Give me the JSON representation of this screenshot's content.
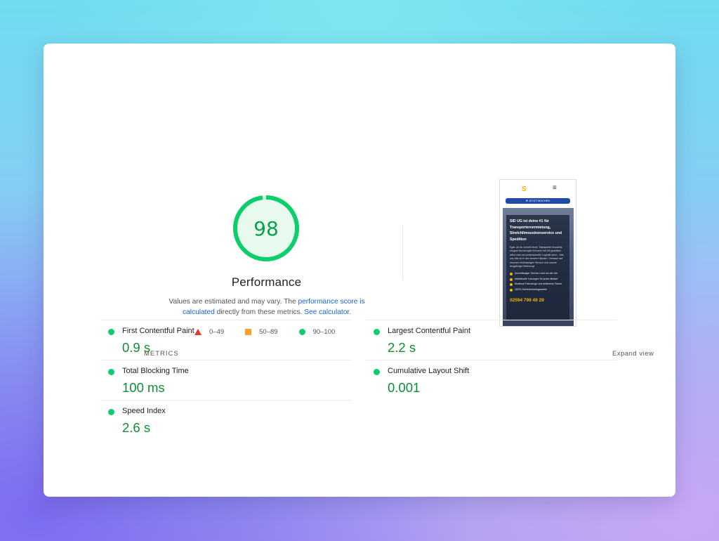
{
  "performance": {
    "score": "98",
    "title": "Performance",
    "score_fraction": 0.98,
    "desc_prefix": "Values are estimated and may vary. The ",
    "desc_link1": "performance score is calculated",
    "desc_middle": " directly from these metrics. ",
    "desc_link2": "See calculator",
    "desc_suffix": "."
  },
  "legend": {
    "fail": "0–49",
    "average": "50–89",
    "pass": "90–100"
  },
  "thumbnail": {
    "logo": "S",
    "menu": "≡",
    "button": "✉ JETZT BUCHEN",
    "heading": "SID UG ist deine #1 für Transportervermietung, Stretchlimousinenservice und Spedition",
    "paragraph": "Egal, ob du schnell einen Transporter brauchst, elegant bevorzugter Moment mit Stil gestalten willst oder auf professionelle Logistik setzt – bist uns bist du in den besten Händen. Vertraue auf unseren erstklassigen Service und unsere langjährige Erfahrung!",
    "list": [
      "Zuverlässiger Service rund um die Uhr",
      "Individuelle Lösungen für jeden Bedarf",
      "Moderne Fahrzeuge und erfahrene Fahrer",
      "100% Zufriedenheitsgarantie"
    ],
    "phone": "02594 799 49 29"
  },
  "metrics": {
    "label": "METRICS",
    "expand": "Expand view",
    "items": [
      {
        "name": "First Contentful Paint",
        "value": "0.9 s"
      },
      {
        "name": "Largest Contentful Paint",
        "value": "2.2 s"
      },
      {
        "name": "Total Blocking Time",
        "value": "100 ms"
      },
      {
        "name": "Cumulative Layout Shift",
        "value": "0.001"
      },
      {
        "name": "Speed Index",
        "value": "2.6 s"
      }
    ]
  },
  "colors": {
    "pass": "#0cce6b",
    "pass_text": "#0c8f33",
    "average": "#f9a32b",
    "fail": "#e5372a",
    "link": "#1a64d8"
  }
}
